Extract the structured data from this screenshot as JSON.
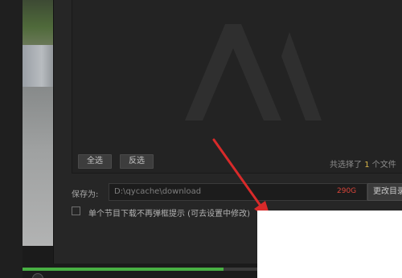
{
  "dialog": {
    "select_all_label": "全选",
    "invert_label": "反选",
    "selected_summary": {
      "prefix": "共选择了",
      "count": "1",
      "suffix": "个文件"
    },
    "save_label": "保存为:",
    "save_path": "D:\\qycache\\download",
    "free_space": "290G",
    "change_dir_label": "更改目录",
    "no_popup_checkbox": {
      "checked": false,
      "label": "单个节目下载不再弹框提示 (可去设置中修改)"
    }
  },
  "player": {
    "progress_fraction": 0.53
  },
  "colors": {
    "accent_green": "#48b043",
    "count_yellow": "#d6b44a",
    "free_space_red": "#d9453a",
    "annotation_arrow": "#d82a2a"
  }
}
